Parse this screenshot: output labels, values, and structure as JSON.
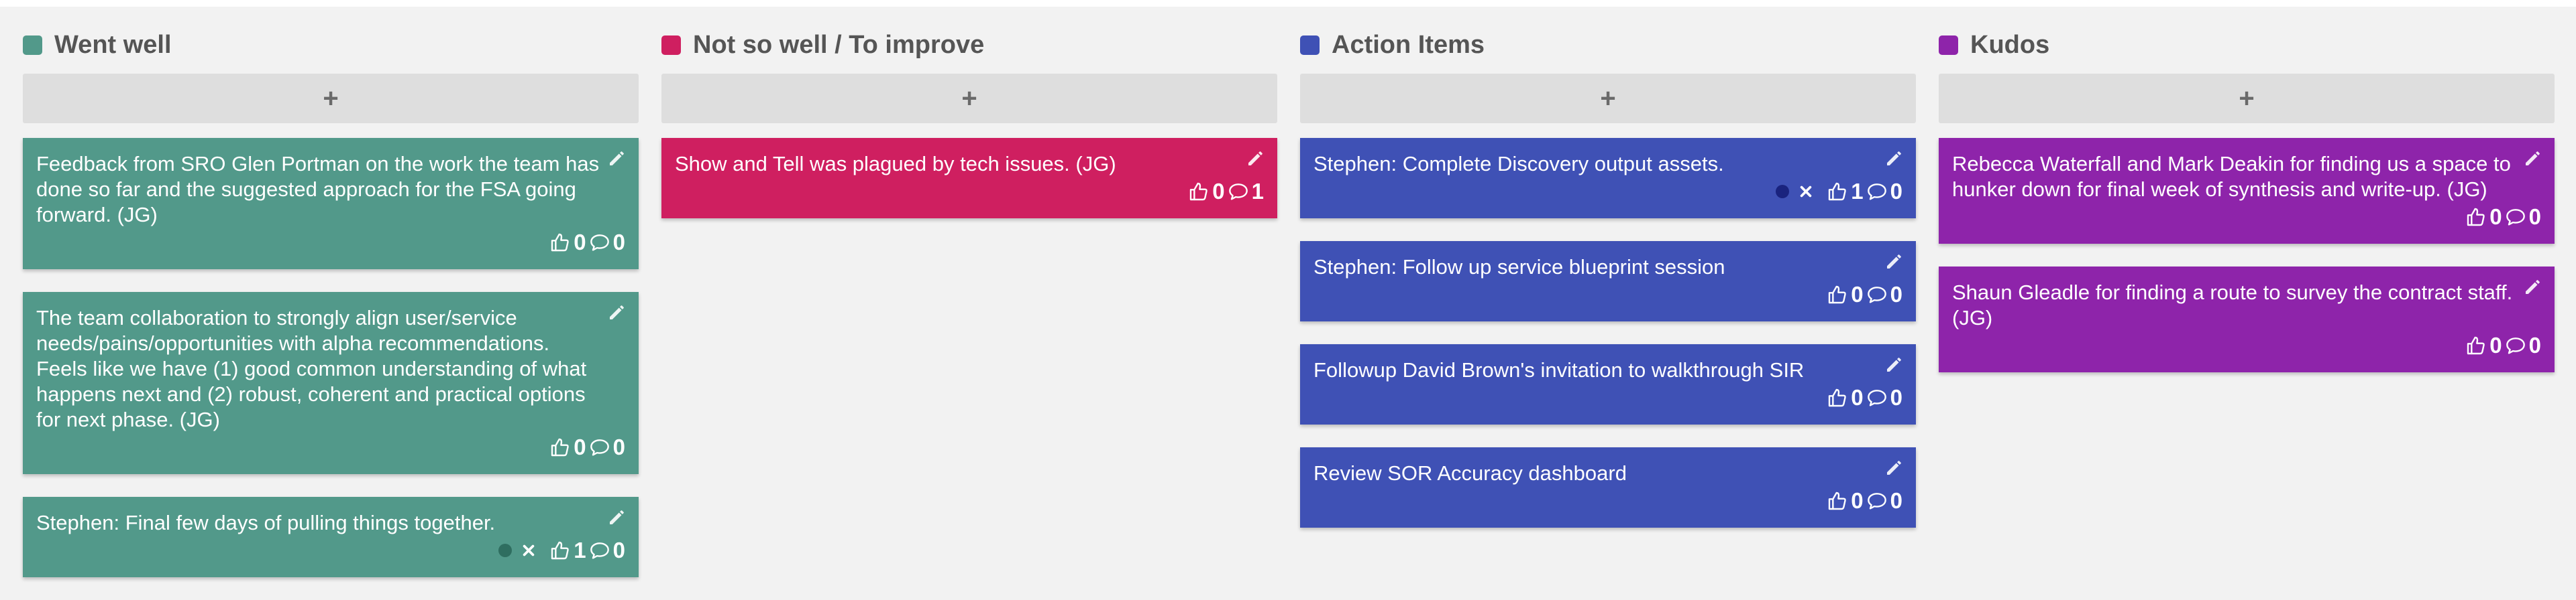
{
  "board": {
    "add_label": "+",
    "columns": [
      {
        "title": "Went well",
        "color": "#52998a",
        "cards": [
          {
            "text": "Feedback from SRO Glen Portman on the work the team has done so far and the suggested approach for the FSA going forward. (JG)",
            "likes": "0",
            "comments": "0",
            "has_action": false
          },
          {
            "text": "The team collaboration to strongly align user/service needs/pains/opportunities with alpha recommendations. Feels like we have (1) good common understanding of what happens next and (2) robust, coherent and practical options for next phase. (JG)",
            "likes": "0",
            "comments": "0",
            "has_action": false
          },
          {
            "text": "Stephen: Final few days of pulling things together.",
            "likes": "1",
            "comments": "0",
            "has_action": true,
            "dot_color": "#2f6e60"
          }
        ]
      },
      {
        "title": "Not so well / To improve",
        "color": "#cf1f60",
        "cards": [
          {
            "text": "Show and Tell was plagued by tech issues. (JG)",
            "likes": "0",
            "comments": "1",
            "has_action": false
          }
        ]
      },
      {
        "title": "Action Items",
        "color": "#3f51b5",
        "cards": [
          {
            "text": "Stephen: Complete Discovery output assets.",
            "likes": "1",
            "comments": "0",
            "has_action": true,
            "dot_color": "#1a237e"
          },
          {
            "text": "Stephen: Follow up service blueprint session",
            "likes": "0",
            "comments": "0",
            "has_action": false
          },
          {
            "text": "Followup David Brown's invitation to walkthrough SIR",
            "likes": "0",
            "comments": "0",
            "has_action": false
          },
          {
            "text": "Review SOR Accuracy dashboard",
            "likes": "0",
            "comments": "0",
            "has_action": false
          }
        ]
      },
      {
        "title": "Kudos",
        "color": "#8e24aa",
        "cards": [
          {
            "text": "Rebecca Waterfall and Mark Deakin for finding us a space to hunker down for final week of synthesis and write-up. (JG)",
            "likes": "0",
            "comments": "0",
            "has_action": false
          },
          {
            "text": "Shaun Gleadle for finding a route to survey the contract staff. (JG)",
            "likes": "0",
            "comments": "0",
            "has_action": false
          }
        ]
      }
    ]
  },
  "icons": {
    "edit": "pencil-icon",
    "like": "thumbs-up-icon",
    "comment": "comment-icon",
    "remove": "close-icon"
  }
}
